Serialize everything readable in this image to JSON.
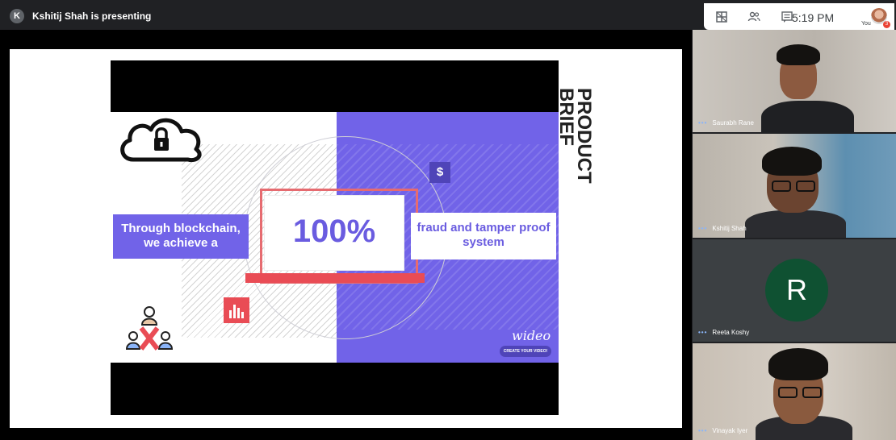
{
  "meeting": {
    "presenter_initial": "K",
    "presenter_text": "Kshitij Shah is presenting",
    "time": "5:19 PM",
    "self_label": "You",
    "notification_count": "3"
  },
  "slide": {
    "title_line1": "PRODUCT",
    "title_line2": "BRIEF",
    "left_label": "Through blockchain, we achieve a",
    "big_value": "100%",
    "right_label": "fraud and tamper proof system",
    "dollar_symbol": "$",
    "logo_text": "wideo",
    "cta_text": "CREATE YOUR VIDEO!"
  },
  "participants": [
    {
      "name": "Saurabh Rane"
    },
    {
      "name": "Kshitij Shah"
    },
    {
      "name": "Reeta Koshy",
      "initial": "R"
    },
    {
      "name": "Vinayak Iyer"
    }
  ],
  "icons": [
    "layout-icon",
    "people-icon",
    "chat-icon",
    "lock-icon",
    "dollar-icon",
    "chart-icon",
    "people-conflict-icon",
    "more-dots-icon"
  ],
  "colors": {
    "accent_purple": "#7163e8",
    "accent_red": "#e94c55",
    "avatar_green": "#0f5132",
    "dots_blue": "#8ab4f8"
  }
}
